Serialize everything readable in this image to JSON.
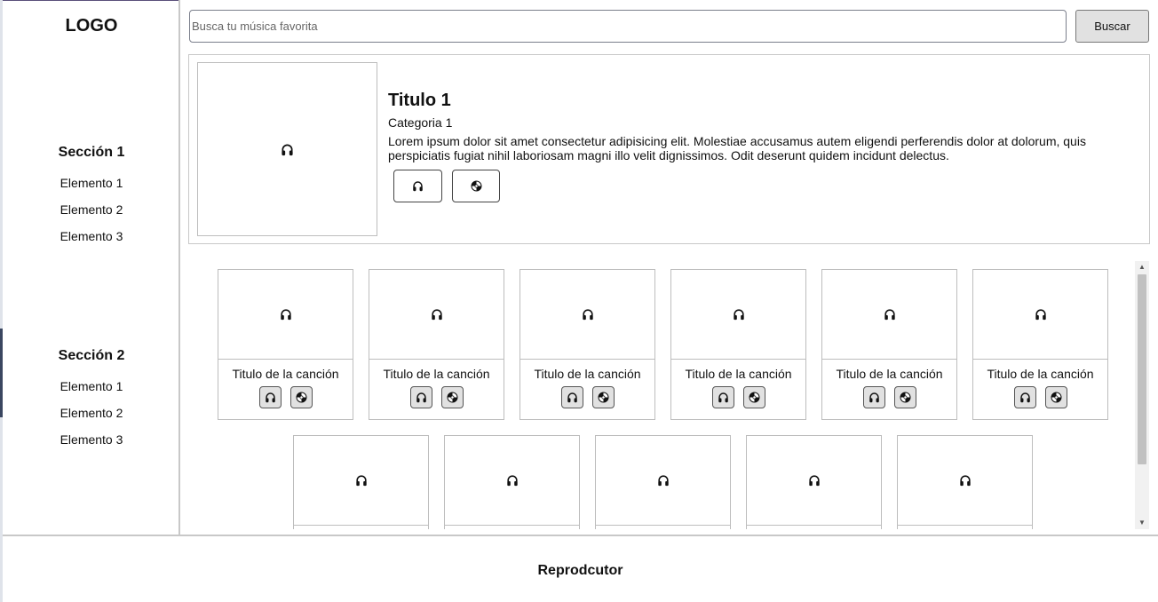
{
  "logo": "LOGO",
  "sidebar": {
    "sections": [
      {
        "title": "Sección 1",
        "items": [
          "Elemento 1",
          "Elemento 2",
          "Elemento 3"
        ]
      },
      {
        "title": "Sección 2",
        "items": [
          "Elemento 1",
          "Elemento 2",
          "Elemento 3"
        ]
      }
    ]
  },
  "search": {
    "placeholder": "Busca tu música favorita",
    "value": "",
    "button_label": "Buscar"
  },
  "featured": {
    "title": "Titulo 1",
    "category": "Categoria 1",
    "description": "Lorem ipsum dolor sit amet consectetur adipisicing elit. Molestiae accusamus autem eligendi perferendis dolor at dolorum, quis perspiciatis fugiat nihil laboriosam magni illo velit dignissimos. Odit deserunt quidem incidunt delectus.",
    "image_icon": "headphones-icon",
    "buttons": [
      {
        "icon": "headphones-icon"
      },
      {
        "icon": "disc-icon"
      }
    ]
  },
  "songs": [
    {
      "title": "Titulo de la canción",
      "icon": "headphones-icon"
    },
    {
      "title": "Titulo de la canción",
      "icon": "headphones-icon"
    },
    {
      "title": "Titulo de la canción",
      "icon": "headphones-icon"
    },
    {
      "title": "Titulo de la canción",
      "icon": "headphones-icon"
    },
    {
      "title": "Titulo de la canción",
      "icon": "headphones-icon"
    },
    {
      "title": "Titulo de la canción",
      "icon": "headphones-icon"
    },
    {
      "title": "",
      "icon": "headphones-icon"
    },
    {
      "title": "",
      "icon": "headphones-icon"
    },
    {
      "title": "",
      "icon": "headphones-icon"
    },
    {
      "title": "",
      "icon": "headphones-icon"
    },
    {
      "title": "",
      "icon": "headphones-icon"
    }
  ],
  "player": {
    "label": "Reprodcutor"
  }
}
